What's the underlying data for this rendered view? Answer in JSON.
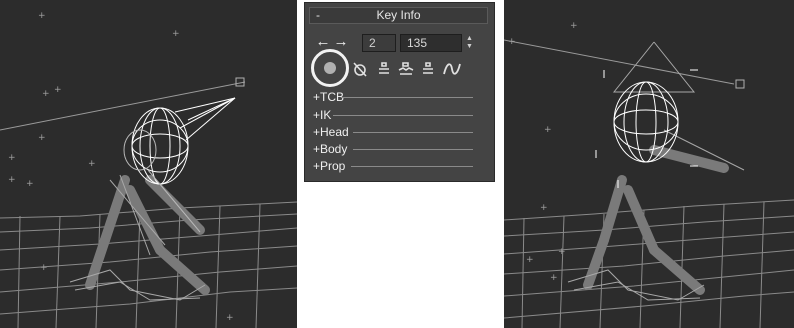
{
  "panel": {
    "collapse_symbol": "-",
    "title": "Key Info",
    "key_number": "2",
    "key_time": "135",
    "colors": {
      "panel_bg": "#444444",
      "viewport_bg": "#2c2c2c",
      "highlight": "#f2f2f2"
    },
    "icons": [
      "prev-key-arrow",
      "next-key-arrow",
      "set-key",
      "lock-key",
      "key-tangent",
      "key-step",
      "key-tangent-2",
      "curve"
    ],
    "rollouts": [
      {
        "label": "+TCB"
      },
      {
        "label": "+IK"
      },
      {
        "label": "+Head"
      },
      {
        "label": "+Body"
      },
      {
        "label": "+Prop"
      }
    ]
  }
}
